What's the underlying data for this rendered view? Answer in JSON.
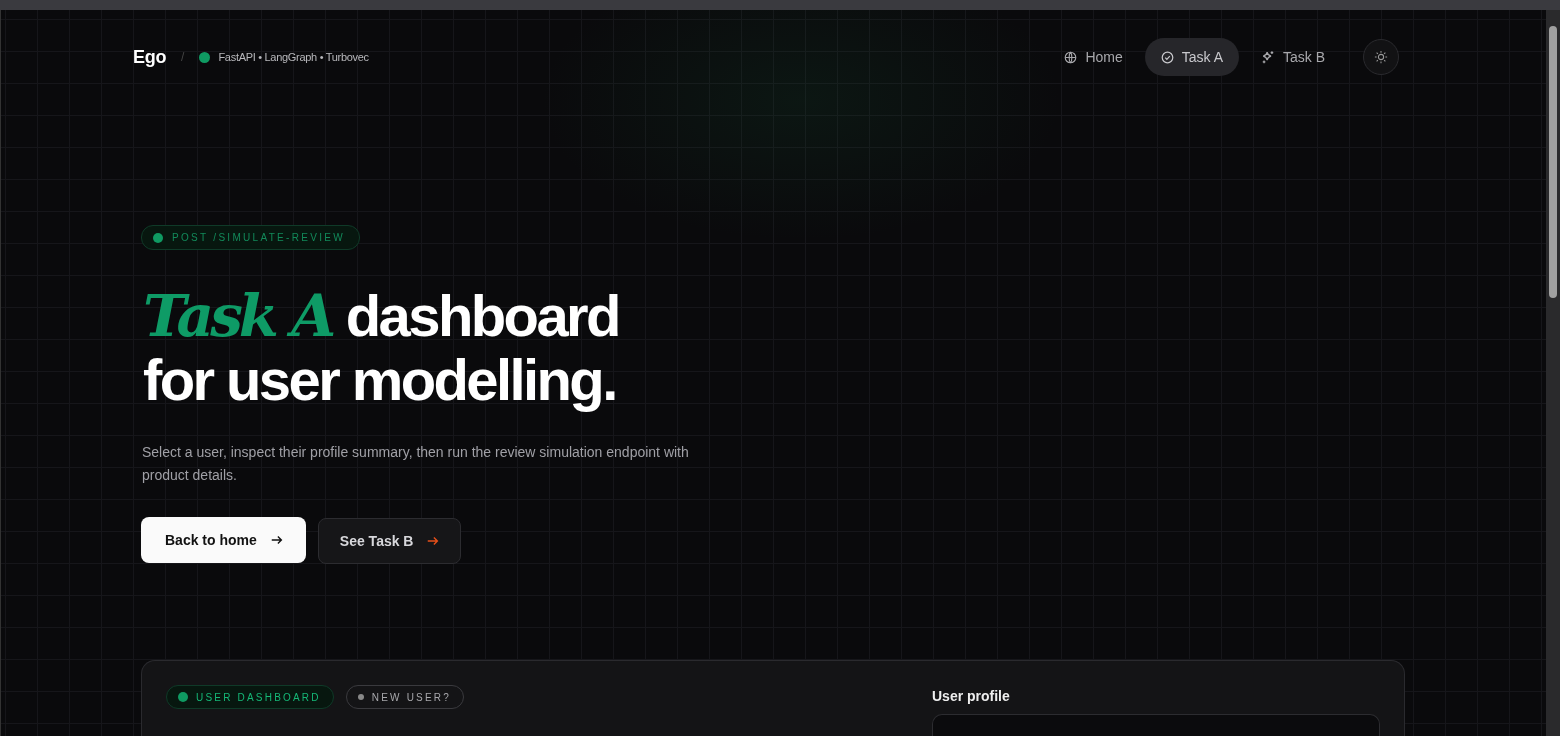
{
  "header": {
    "brand": "Ego",
    "separator": "/",
    "stack": "FastAPI • LangGraph • Turbovec"
  },
  "nav": [
    {
      "label": "Home",
      "selected": false
    },
    {
      "label": "Task A",
      "selected": true
    },
    {
      "label": "Task B",
      "selected": false
    }
  ],
  "hero": {
    "endpoint_badge": "POST /SIMULATE-REVIEW",
    "heading": "*Task A* dashboard for user modelling.",
    "description": "Select a user, inspect their profile summary, then run the review simulation endpoint with product details.",
    "buttons": [
      {
        "label": "Back to home",
        "kind": "primary"
      },
      {
        "label": "See Task B",
        "kind": "secondary"
      }
    ]
  },
  "dashboard": {
    "tags": [
      {
        "label": "USER DASHBOARD",
        "selected": true
      },
      {
        "label": "NEW USER?",
        "selected": false
      }
    ],
    "profile_label": "User profile"
  }
}
